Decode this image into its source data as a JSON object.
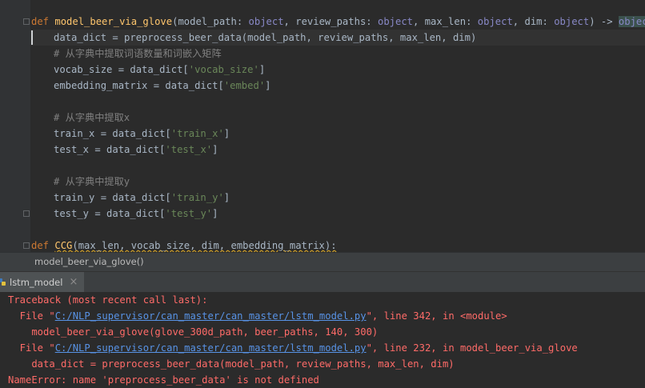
{
  "editor": {
    "code": {
      "def_kw": "def",
      "fn_name": "model_beer_via_glove",
      "params_open": "(",
      "p1": "model_path",
      "colon1": ": ",
      "t1": "object",
      "comma1": ", ",
      "p2": "review_paths",
      "colon2": ": ",
      "t2": "object",
      "comma2": ", ",
      "p3": "max_len",
      "colon3": ": ",
      "t3": "object",
      "comma3": ", ",
      "p4": "dim",
      "colon4": ": ",
      "t4": "object",
      "arrow": ") -> ",
      "ret": "object",
      "end": ":",
      "line2": "data_dict = preprocess_beer_data(model_path, review_paths, max_len, dim)",
      "line3": "# 从字典中提取词语数量和词嵌入矩阵",
      "line4_a": "vocab_size = data_dict[",
      "line4_b": "'vocab_size'",
      "line4_c": "]",
      "line5_a": "embedding_matrix = data_dict[",
      "line5_b": "'embed'",
      "line5_c": "]",
      "line7": "# 从字典中提取x",
      "line8_a": "train_x = data_dict[",
      "line8_b": "'train_x'",
      "line8_c": "]",
      "line9_a": "test_x = data_dict[",
      "line9_b": "'test_x'",
      "line9_c": "]",
      "line11": "# 从字典中提取y",
      "line12_a": "train_y = data_dict[",
      "line12_b": "'train_y'",
      "line12_c": "]",
      "line13_a": "test_y = data_dict[",
      "line13_b": "'test_y'",
      "line13_c": "]",
      "line15_kw": "def",
      "line15_fn": "CCG",
      "line15_rest": "(max_len, vocab_size, dim, embedding_matrix):"
    }
  },
  "breadcrumb": {
    "text": "model_beer_via_glove()"
  },
  "run_panel": {
    "tab_label": "lstm_model",
    "close_glyph": "×"
  },
  "console": {
    "l1": "Traceback (most recent call last):",
    "l2_pre": "  File \"",
    "l2_link": "C:/NLP_supervisor/can_master/can_master/lstm_model.py",
    "l2_post": "\", line 342, in <module>",
    "l3": "    model_beer_via_glove(glove_300d_path, beer_paths, 140, 300)",
    "l4_pre": "  File \"",
    "l4_link": "C:/NLP_supervisor/can_master/can_master/lstm_model.py",
    "l4_post": "\", line 232, in model_beer_via_glove",
    "l5": "    data_dict = preprocess_beer_data(model_path, review_paths, max_len, dim)",
    "l6": "NameError: name 'preprocess_beer_data' is not defined"
  },
  "colors": {
    "editor_bg": "#2b2b2b",
    "keyword": "#cc7832",
    "function": "#ffc66d",
    "comment": "#808080",
    "string": "#6a8759",
    "error": "#ff6b68",
    "link": "#5893e6"
  },
  "icons": {
    "run_tab_icon": "python-file-icon",
    "close": "close-icon"
  }
}
